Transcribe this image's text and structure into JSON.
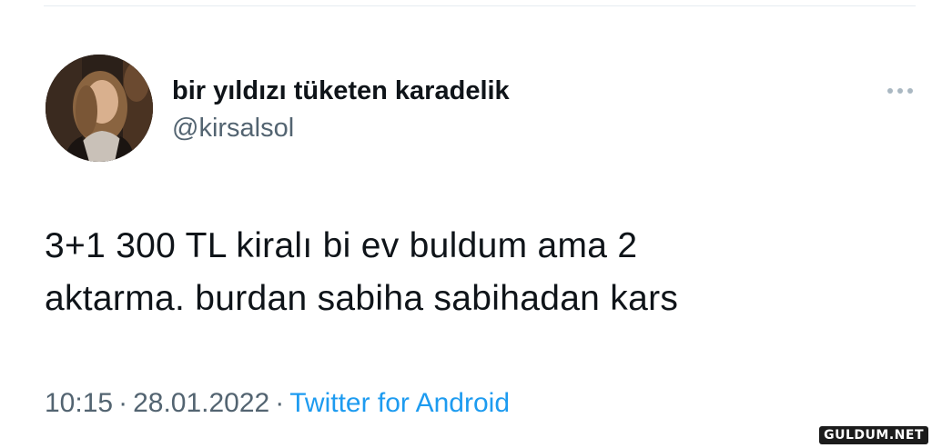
{
  "tweet": {
    "author": {
      "display_name": "bir yıldızı tüketen karadelik",
      "handle": "@kirsalsol"
    },
    "text_lines": [
      "3+1 300 TL kiralı bi ev buldum ama 2",
      "aktarma. burdan sabiha sabihadan kars"
    ],
    "time": "10:15",
    "separator": "·",
    "date": "28.01.2022",
    "source": "Twitter for Android",
    "more_icon": "more-horizontal-icon"
  },
  "watermark": "GULDUM.NET",
  "colors": {
    "text_primary": "#0f1419",
    "text_secondary": "#536471",
    "link": "#1d9bf0"
  }
}
